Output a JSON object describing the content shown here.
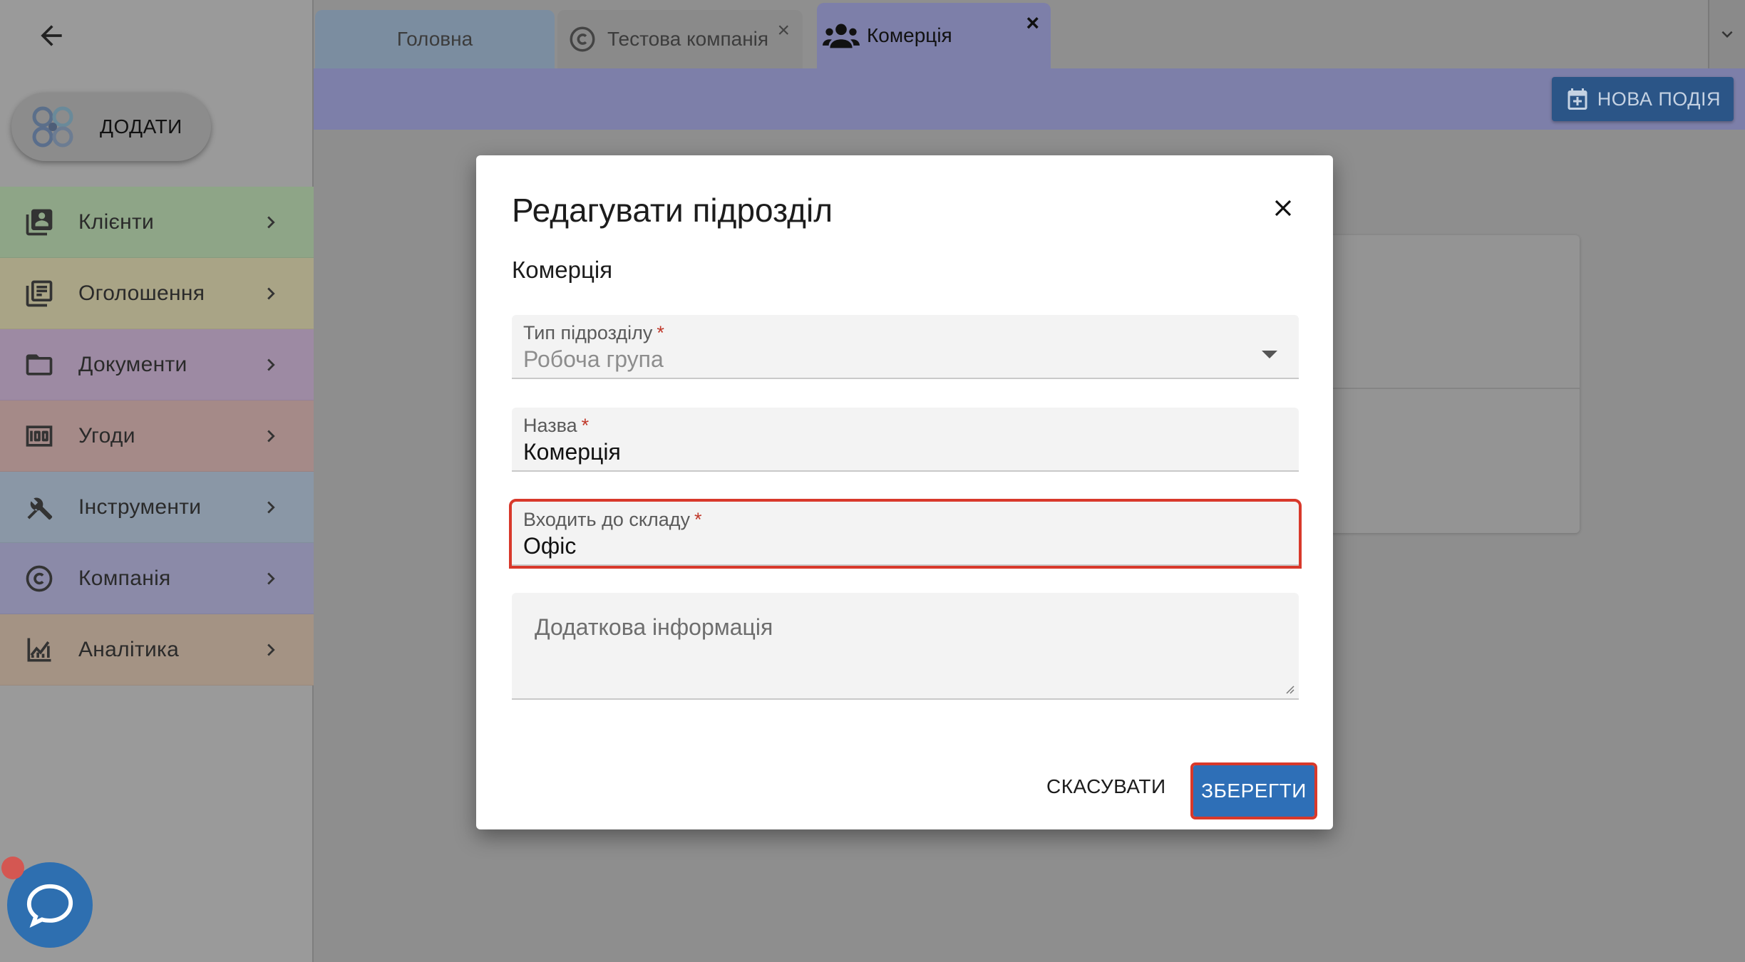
{
  "sidebar": {
    "add_label": "ДОДАТИ",
    "items": [
      {
        "label": "Клієнти",
        "icon": "contacts-icon",
        "color": "#8ea587"
      },
      {
        "label": "Оголошення",
        "icon": "listings-icon",
        "color": "#a9a486"
      },
      {
        "label": "Документи",
        "icon": "folder-icon",
        "color": "#9d8aa3"
      },
      {
        "label": "Угоди",
        "icon": "money-icon",
        "color": "#a58a88"
      },
      {
        "label": "Інструменти",
        "icon": "tools-icon",
        "color": "#8a97a6"
      },
      {
        "label": "Компанія",
        "icon": "copyright-icon",
        "color": "#8b8aa8"
      },
      {
        "label": "Аналітика",
        "icon": "analytics-icon",
        "color": "#a49384"
      }
    ]
  },
  "tabs": [
    {
      "label": "Головна"
    },
    {
      "label": "Тестова компанія",
      "close": "×"
    },
    {
      "label": "Комерція",
      "close": "×"
    }
  ],
  "toolbar": {
    "new_event_label": "НОВА ПОДІЯ"
  },
  "dialog": {
    "title": "Редагувати підрозділ",
    "subtitle": "Комерція",
    "fields": {
      "type": {
        "label": "Тип підрозділу",
        "required": "*",
        "value": "Робоча група"
      },
      "name": {
        "label": "Назва",
        "required": "*",
        "value": "Комерція"
      },
      "parent": {
        "label": "Входить до складу",
        "required": "*",
        "value": "Офіс"
      },
      "info": {
        "placeholder": "Додаткова інформація"
      }
    },
    "cancel_label": "СКАСУВАТИ",
    "save_label": "ЗБЕРЕГТИ"
  },
  "colors": {
    "accent": "#2e6fb7",
    "highlight": "#d8392b",
    "tab_active": "#7d7fa9"
  }
}
